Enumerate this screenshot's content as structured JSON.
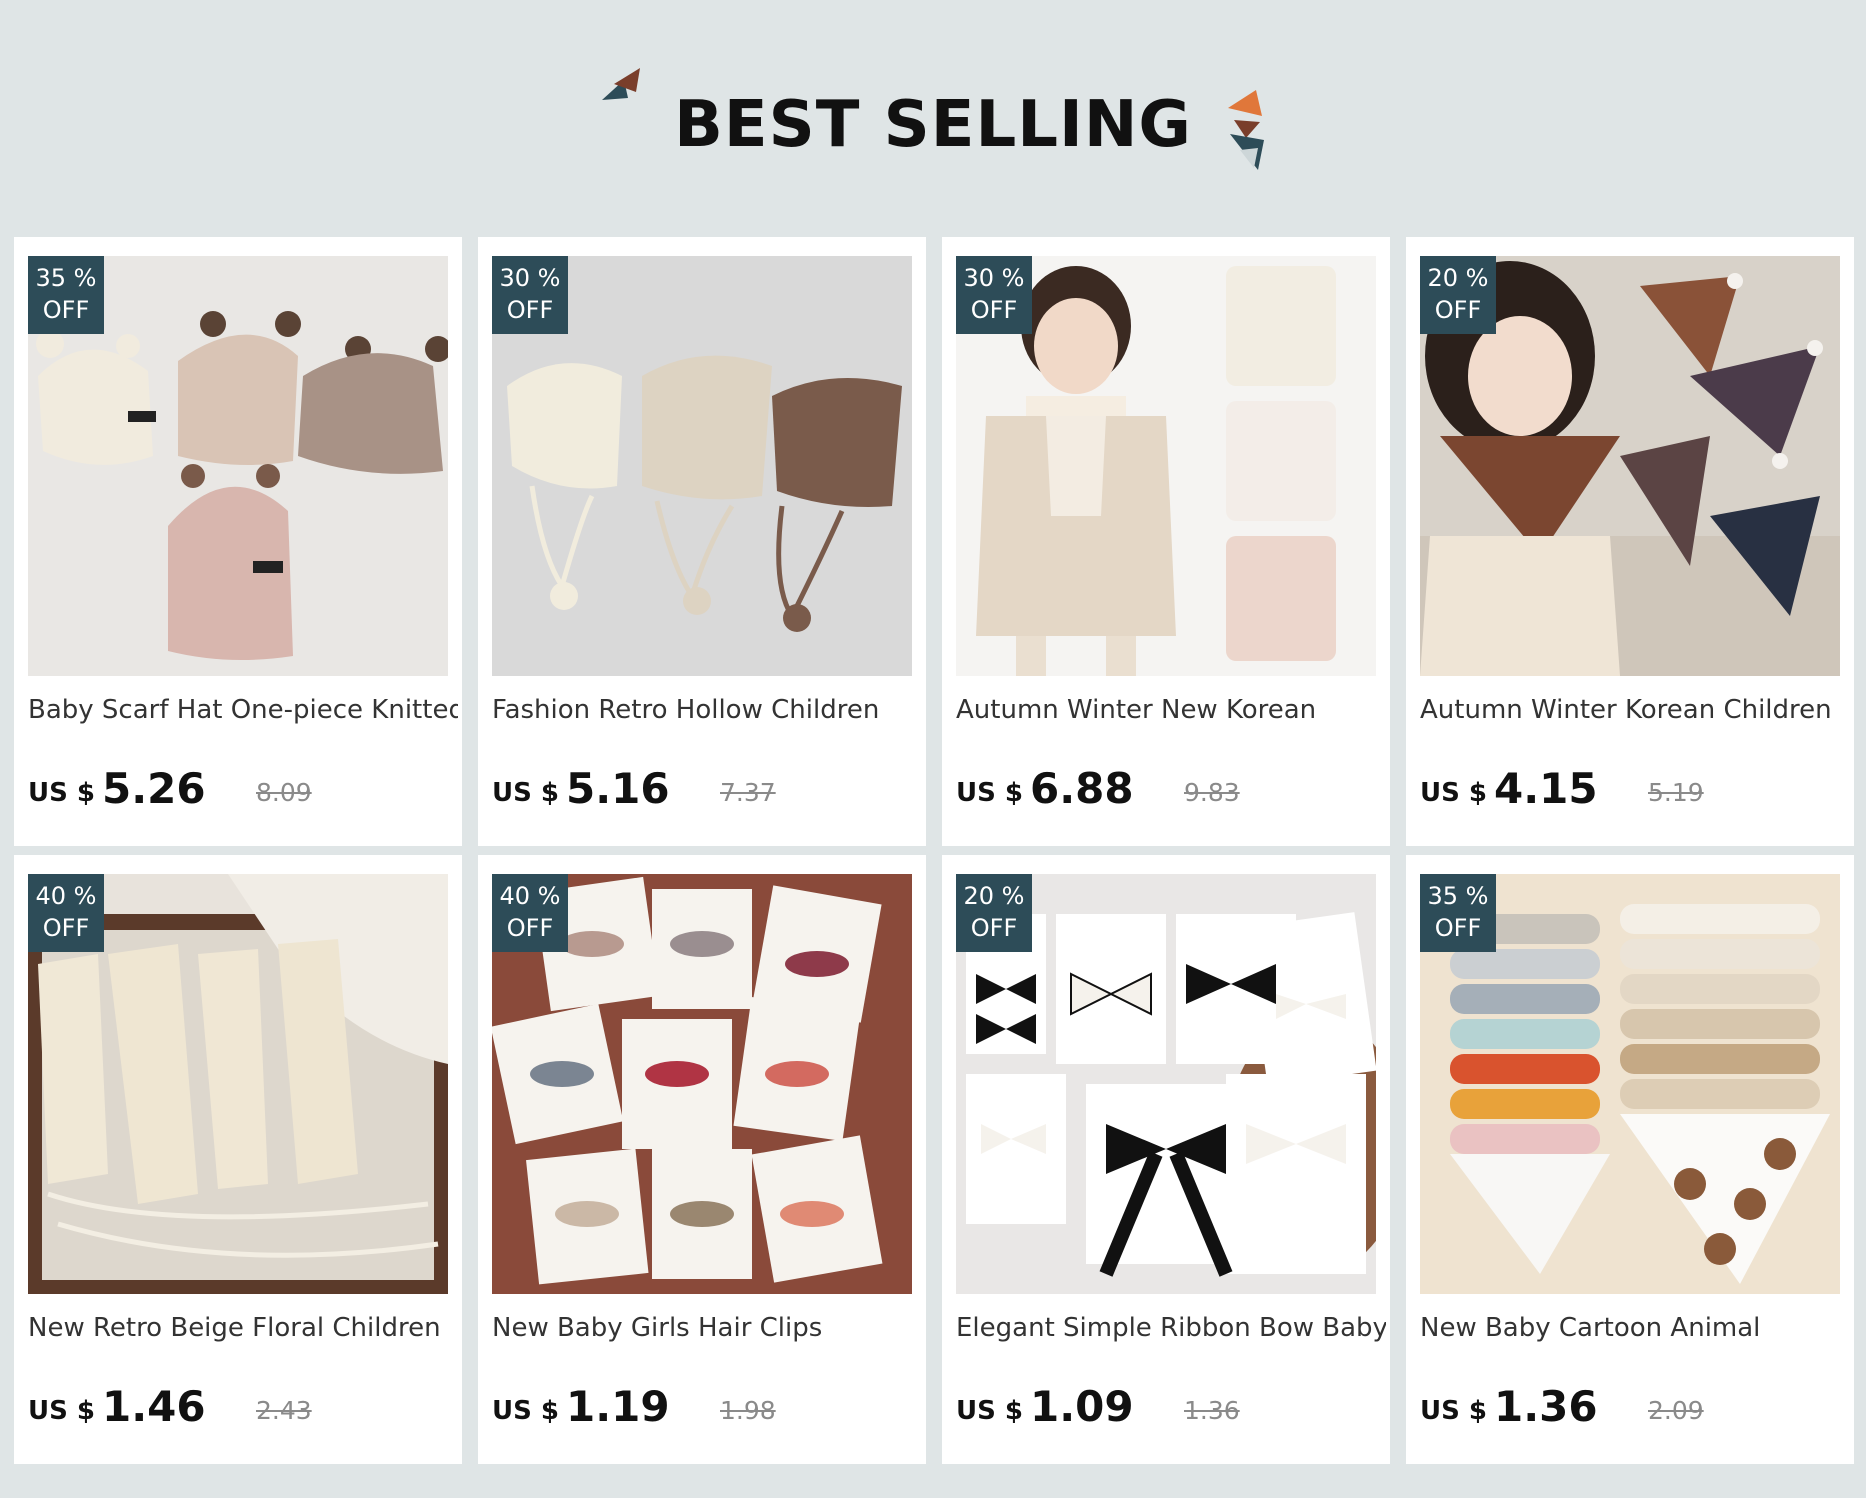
{
  "header": {
    "title": "BEST SELLING"
  },
  "products": [
    {
      "discount_value": "35 %",
      "discount_suffix": "OFF",
      "name": "Baby Scarf Hat One-piece Knitted",
      "currency": "US $",
      "price": "5.26",
      "original_price": "8.09",
      "image": "knitted-bear-hoods-photo"
    },
    {
      "discount_value": "30 %",
      "discount_suffix": "OFF",
      "name": "Fashion Retro Hollow Children",
      "currency": "US $",
      "price": "5.16",
      "original_price": "7.37",
      "image": "crochet-bonnets-photo"
    },
    {
      "discount_value": "30 %",
      "discount_suffix": "OFF",
      "name": "Autumn Winter New Korean",
      "currency": "US $",
      "price": "6.88",
      "original_price": "9.83",
      "image": "floral-vest-girl-photo"
    },
    {
      "discount_value": "20 %",
      "discount_suffix": "OFF",
      "name": "Autumn Winter Korean Children",
      "currency": "US $",
      "price": "4.15",
      "original_price": "5.19",
      "image": "triangle-scarves-girl-photo"
    },
    {
      "discount_value": "40 %",
      "discount_suffix": "OFF",
      "name": "New Retro Beige Floral Children",
      "currency": "US $",
      "price": "1.46",
      "original_price": "2.43",
      "image": "lace-headbands-photo"
    },
    {
      "discount_value": "40 %",
      "discount_suffix": "OFF",
      "name": "New Baby Girls Hair Clips",
      "currency": "US $",
      "price": "1.19",
      "original_price": "1.98",
      "image": "hair-clip-cards-photo"
    },
    {
      "discount_value": "20 %",
      "discount_suffix": "OFF",
      "name": "Elegant Simple Ribbon Bow Baby",
      "currency": "US $",
      "price": "1.09",
      "original_price": "1.36",
      "image": "ribbon-bows-photo"
    },
    {
      "discount_value": "35 %",
      "discount_suffix": "OFF",
      "name": "New Baby Cartoon Animal",
      "currency": "US $",
      "price": "1.36",
      "original_price": "2.09",
      "image": "baby-bibs-photo"
    }
  ],
  "colors": {
    "page_background": "#dfe5e6",
    "badge_background": "#2d4c58",
    "badge_text": "#ffffff",
    "old_price": "#8a8a8a",
    "deco_orange": "#e0773a",
    "deco_dark": "#2d4c58",
    "deco_brown": "#7a3e2b"
  }
}
